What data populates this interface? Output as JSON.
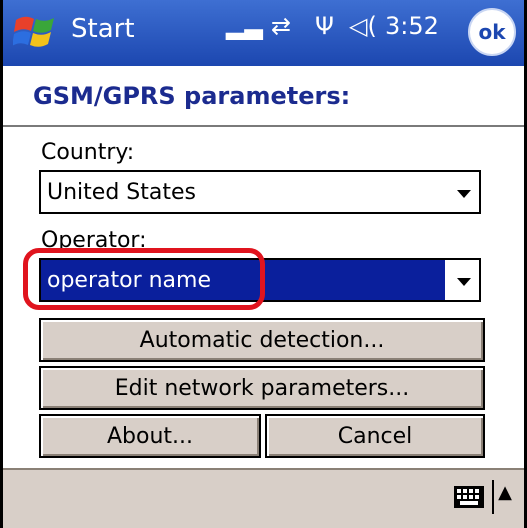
{
  "taskbar": {
    "start_label": "Start",
    "signal": "▂▃",
    "sync": "⇄",
    "antenna": "Ψ",
    "speaker": "◁(",
    "time": "3:52",
    "ok_label": "ok"
  },
  "page": {
    "heading": "GSM/GPRS parameters:"
  },
  "form": {
    "country_label": "Country:",
    "country_value": "United States",
    "operator_label": "Operator:",
    "operator_value": "operator name"
  },
  "buttons": {
    "auto_detect": "Automatic detection...",
    "edit_params": "Edit network parameters...",
    "about": "About...",
    "cancel": "Cancel"
  },
  "colors": {
    "taskbar": "#1c47b0",
    "selection": "#0a1f9c",
    "highlight_ring": "#e0141e",
    "button_face": "#d8cfc8"
  },
  "icons": {
    "start": "windows-flag-icon",
    "keyboard": "keyboard-icon",
    "sip": "sip-arrow-icon"
  }
}
